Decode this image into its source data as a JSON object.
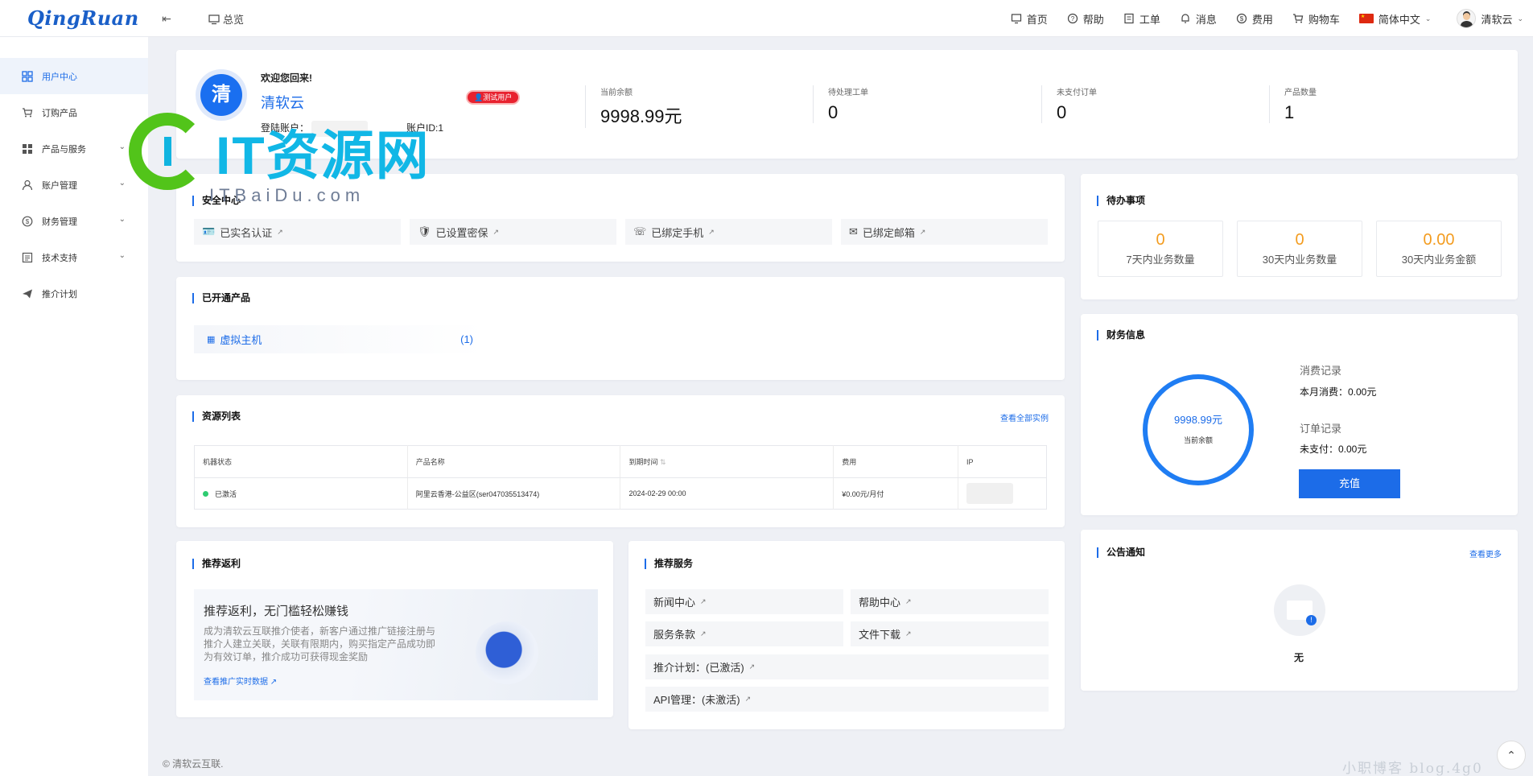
{
  "topbar": {
    "logo": "QingRuan",
    "overview_label": "总览",
    "nav": [
      {
        "label": "首页"
      },
      {
        "label": "帮助"
      },
      {
        "label": "工单"
      },
      {
        "label": "消息"
      },
      {
        "label": "费用"
      },
      {
        "label": "购物车"
      }
    ],
    "language": "简体中文",
    "user": "清软云"
  },
  "sidebar": {
    "items": [
      {
        "label": "用户中心",
        "icon": "grid-icon",
        "active": true
      },
      {
        "label": "订购产品",
        "icon": "cart-icon"
      },
      {
        "label": "产品与服务",
        "icon": "apps-icon"
      },
      {
        "label": "账户管理",
        "icon": "user-icon"
      },
      {
        "label": "财务管理",
        "icon": "money-icon"
      },
      {
        "label": "技术支持",
        "icon": "doc-icon"
      },
      {
        "label": "推介计划",
        "icon": "send-icon"
      }
    ]
  },
  "welcome": {
    "avatar_char": "清",
    "greeting": "欢迎您回来!",
    "name": "清软云",
    "badge": "测试用户",
    "login_account_label": "登陆账户：",
    "account_id": "账户ID:1",
    "stats": [
      {
        "label": "当前余额",
        "value": "9998.99元"
      },
      {
        "label": "待处理工单",
        "value": "0"
      },
      {
        "label": "未支付订单",
        "value": "0"
      },
      {
        "label": "产品数量",
        "value": "1"
      }
    ]
  },
  "security": {
    "title": "安全中心",
    "items": [
      {
        "label": "已实名认证",
        "icon": "id-card-icon"
      },
      {
        "label": "已设置密保",
        "icon": "shield-icon"
      },
      {
        "label": "已绑定手机",
        "icon": "phone-icon"
      },
      {
        "label": "已绑定邮箱",
        "icon": "mail-icon"
      }
    ]
  },
  "products": {
    "title": "已开通产品",
    "items": [
      {
        "label": "虚拟主机",
        "count": "(1)"
      }
    ]
  },
  "resources": {
    "title": "资源列表",
    "view_all": "查看全部实例",
    "columns": [
      "机器状态",
      "产品名称",
      "到期时间",
      "费用",
      "IP"
    ],
    "rows": [
      {
        "status": "已激活",
        "name": "阿里云香港-公益区(ser047035513474)",
        "expire": "2024-02-29 00:00",
        "fee": "¥0.00元/月付",
        "ip": ""
      }
    ]
  },
  "referral": {
    "title": "推荐返利",
    "headline": "推荐返利，无门槛轻松赚钱",
    "desc": "成为清软云互联推介使者，新客户通过推广链接注册与推介人建立关联，关联有限期内，购买指定产品成功即为有效订单，推介成功可获得现金奖励",
    "link": "查看推广实时数据"
  },
  "services": {
    "title": "推荐服务",
    "items": [
      "新闻中心",
      "帮助中心",
      "服务条款",
      "文件下载",
      "推介计划：(已激活)",
      "API管理：(未激活)"
    ]
  },
  "todo": {
    "title": "待办事项",
    "items": [
      {
        "value": "0",
        "label": "7天内业务数量"
      },
      {
        "value": "0",
        "label": "30天内业务数量"
      },
      {
        "value": "0.00",
        "label": "30天内业务金额"
      }
    ]
  },
  "finance": {
    "title": "财务信息",
    "balance": "9998.99元",
    "balance_label": "当前余额",
    "consume_title": "消费记录",
    "consume_value": "本月消费：0.00元",
    "order_title": "订单记录",
    "order_value": "未支付：0.00元",
    "recharge": "充值"
  },
  "notice": {
    "title": "公告通知",
    "more": "查看更多",
    "empty": "无"
  },
  "footer": "© 清软云互联.",
  "watermark": {
    "main": "IT资源网",
    "sub": "ITBaiDu.com",
    "corner": "小职博客 blog.4g0"
  },
  "colors": {
    "accent": "#1c6ce8",
    "orange": "#f39c1f",
    "active_green": "#2ecc71",
    "badge_red": "#e8222f"
  }
}
